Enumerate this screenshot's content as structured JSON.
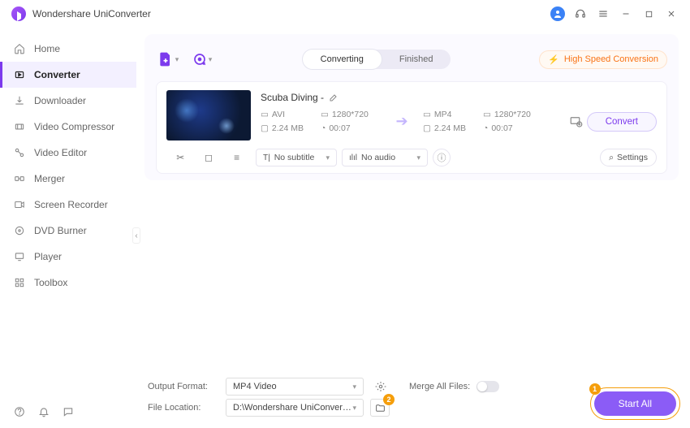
{
  "app": {
    "title": "Wondershare UniConverter"
  },
  "titlebar": {
    "callouts": {
      "one": "1",
      "two": "2"
    }
  },
  "sidebar": {
    "items": [
      {
        "label": "Home"
      },
      {
        "label": "Converter"
      },
      {
        "label": "Downloader"
      },
      {
        "label": "Video Compressor"
      },
      {
        "label": "Video Editor"
      },
      {
        "label": "Merger"
      },
      {
        "label": "Screen Recorder"
      },
      {
        "label": "DVD Burner"
      },
      {
        "label": "Player"
      },
      {
        "label": "Toolbox"
      }
    ]
  },
  "tabs": {
    "converting": "Converting",
    "finished": "Finished"
  },
  "hispeed": "High Speed Conversion",
  "file": {
    "name": "Scuba Diving -",
    "src": {
      "fmt": "AVI",
      "res": "1280*720",
      "size": "2.24 MB",
      "dur": "00:07"
    },
    "dst": {
      "fmt": "MP4",
      "res": "1280*720",
      "size": "2.24 MB",
      "dur": "00:07"
    },
    "convert": "Convert",
    "subtitle": "No subtitle",
    "audio": "No audio",
    "settings": "Settings"
  },
  "bottom": {
    "format_label": "Output Format:",
    "format_value": "MP4 Video",
    "location_label": "File Location:",
    "location_value": "D:\\Wondershare UniConverter",
    "merge_label": "Merge All Files:",
    "start_all": "Start All"
  }
}
